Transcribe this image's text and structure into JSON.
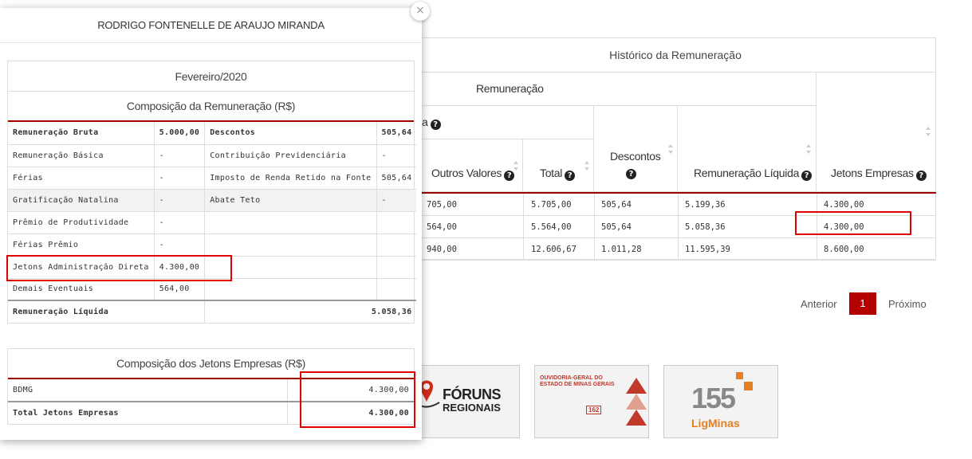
{
  "history": {
    "title": "Histórico da Remuneração",
    "group_header": "Remuneração",
    "sub_group_fragment": "a",
    "columns": [
      "Outros Valores",
      "Total",
      "Descontos",
      "Remuneração Líquida",
      "Jetons Empresas"
    ],
    "rows": [
      [
        "705,00",
        "5.705,00",
        "505,64",
        "5.199,36",
        "4.300,00"
      ],
      [
        "564,00",
        "5.564,00",
        "505,64",
        "5.058,36",
        "4.300,00"
      ],
      [
        "940,00",
        "12.606,67",
        "1.011,28",
        "11.595,39",
        "8.600,00"
      ]
    ]
  },
  "pagination": {
    "prev": "Anterior",
    "current": "1",
    "next": "Próximo"
  },
  "banners": {
    "foruns": {
      "line1": "FÓRUNS",
      "line2": "REGIONAIS"
    },
    "ouvidoria": {
      "line1": "OUVIDORIA-GERAL DO",
      "line2": "ESTADO DE MINAS GERAIS",
      "number": "162"
    },
    "ligminas": {
      "number": "155",
      "name": "LigMinas"
    }
  },
  "modal": {
    "title": "RODRIGO FONTENELLE DE ARAUJO MIRANDA",
    "close_icon": "close-icon",
    "period": "Fevereiro/2020",
    "composition_title": "Composição da Remuneração (R$)",
    "rows": [
      [
        "Remuneração Bruta",
        "5.000,00",
        "Descontos",
        "505,64"
      ],
      [
        "Remuneração Básica",
        "-",
        "Contribuição Previdenciária",
        "-"
      ],
      [
        "Férias",
        "-",
        "Imposto de Renda Retido na Fonte",
        "505,64"
      ],
      [
        "Gratificação Natalina",
        "-",
        "Abate Teto",
        "-"
      ],
      [
        "Prêmio de Produtividade",
        "-",
        "",
        ""
      ],
      [
        "Férias Prêmio",
        "-",
        "",
        ""
      ],
      [
        "Jetons Administração Direta",
        "4.300,00",
        "",
        ""
      ],
      [
        "Demais Eventuais",
        "564,00",
        "",
        ""
      ]
    ],
    "net_label": "Remuneração Líquida",
    "net_value": "5.058,36",
    "jetons_title": "Composição dos Jetons Empresas (R$)",
    "jetons_rows": [
      [
        "BDMG",
        "4.300,00"
      ]
    ],
    "jetons_total_label": "Total Jetons Empresas",
    "jetons_total_value": "4.300,00"
  },
  "colors": {
    "accent_red": "#b30000",
    "highlight_red": "#e00000"
  }
}
